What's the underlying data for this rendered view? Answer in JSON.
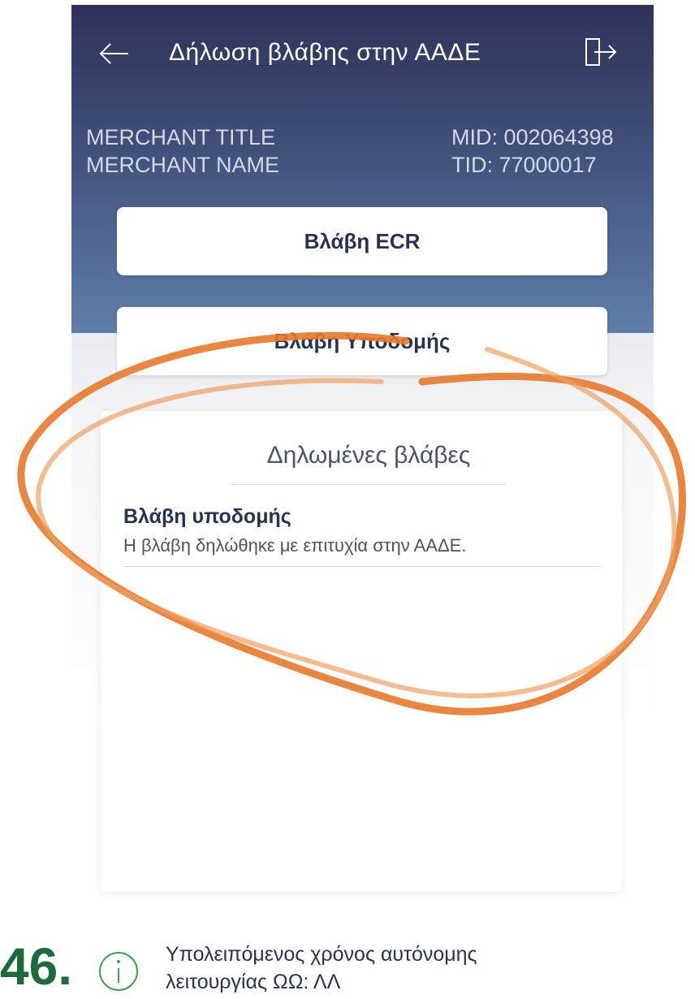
{
  "header": {
    "title": "Δήλωση βλάβης στην ΑΑΔΕ",
    "back_icon": "arrow-left-icon",
    "exit_icon": "logout-icon"
  },
  "merchant": {
    "title": "MERCHANT TITLE",
    "name": "MERCHANT NAME",
    "mid": "MID: 002064398",
    "tid": "TID: 77000017"
  },
  "buttons": {
    "ecr": "Βλάβη ECR",
    "infrastructure": "Βλάβη Υποδομής"
  },
  "declared": {
    "title": "Δηλωμένες βλάβες",
    "items": [
      {
        "title": "Βλάβη υποδομής",
        "description": "Η βλάβη δηλώθηκε με επιτυχία στην ΑΑΔΕ."
      }
    ]
  },
  "footer": {
    "step": "46.",
    "info_icon": "info-icon",
    "remaining_line1": "Υπολειπόμενος χρόνος αυτόνομης",
    "remaining_line2": "λειτουργίας ΩΩ: ΛΛ"
  },
  "colors": {
    "header_top": "#2f3258",
    "header_bottom": "#5f7fa8",
    "annotation": "#e8792a",
    "step_green": "#1d6a3a"
  }
}
